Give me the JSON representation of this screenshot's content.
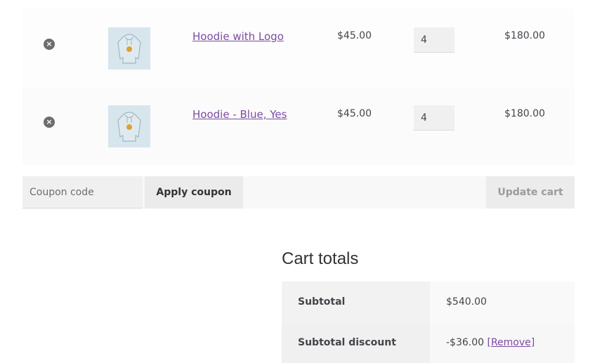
{
  "cart": {
    "items": [
      {
        "name": "Hoodie with Logo",
        "price": "$45.00",
        "quantity": "4",
        "total": "$180.00",
        "remove_icon": "×"
      },
      {
        "name": "Hoodie - Blue, Yes",
        "price": "$45.00",
        "quantity": "4",
        "total": "$180.00",
        "remove_icon": "×"
      }
    ],
    "coupon_placeholder": "Coupon code",
    "apply_coupon_label": "Apply coupon",
    "update_cart_label": "Update cart"
  },
  "totals": {
    "title": "Cart totals",
    "subtotal_label": "Subtotal",
    "subtotal_value": "$540.00",
    "discount_label": "Subtotal discount",
    "discount_value": "-$36.00",
    "remove_link": "[Remove]"
  },
  "colors": {
    "link": "#7c4ba0",
    "remove_icon_bg": "#6d6d6d"
  }
}
